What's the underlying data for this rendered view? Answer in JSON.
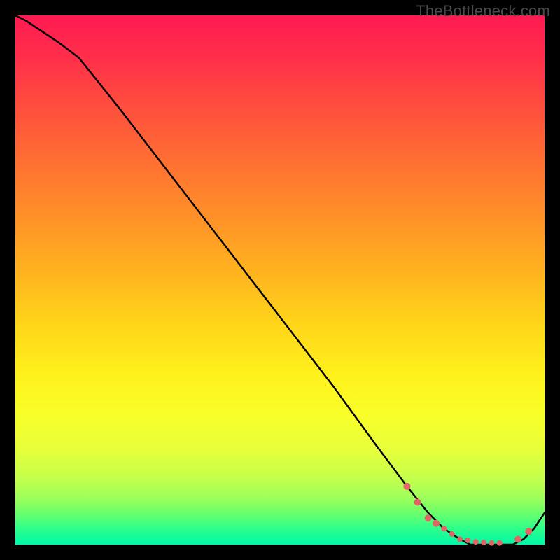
{
  "watermark": {
    "text": "TheBottleneck.com"
  },
  "chart_data": {
    "type": "line",
    "title": "",
    "xlabel": "",
    "ylabel": "",
    "xlim": [
      0,
      100
    ],
    "ylim": [
      0,
      100
    ],
    "series": [
      {
        "name": "curve",
        "x": [
          0,
          2,
          5,
          8,
          12,
          20,
          30,
          40,
          50,
          60,
          68,
          74,
          78,
          81,
          84,
          86,
          88,
          90,
          92,
          94,
          96,
          98,
          100
        ],
        "values": [
          100,
          99,
          97,
          95,
          92,
          82,
          69,
          56,
          43,
          30,
          19,
          11,
          6,
          3,
          1,
          0,
          0,
          0,
          0,
          0,
          1,
          3,
          6
        ]
      }
    ],
    "markers": {
      "name": "highlight-dots",
      "color": "#e06666",
      "x": [
        74,
        76,
        78,
        79.5,
        81,
        82.5,
        84,
        85.5,
        87,
        88.5,
        90,
        91.5,
        95,
        97
      ],
      "values": [
        11,
        8,
        5,
        4,
        3,
        2,
        1,
        0.8,
        0.5,
        0.4,
        0.3,
        0.3,
        1,
        2.5
      ]
    }
  }
}
